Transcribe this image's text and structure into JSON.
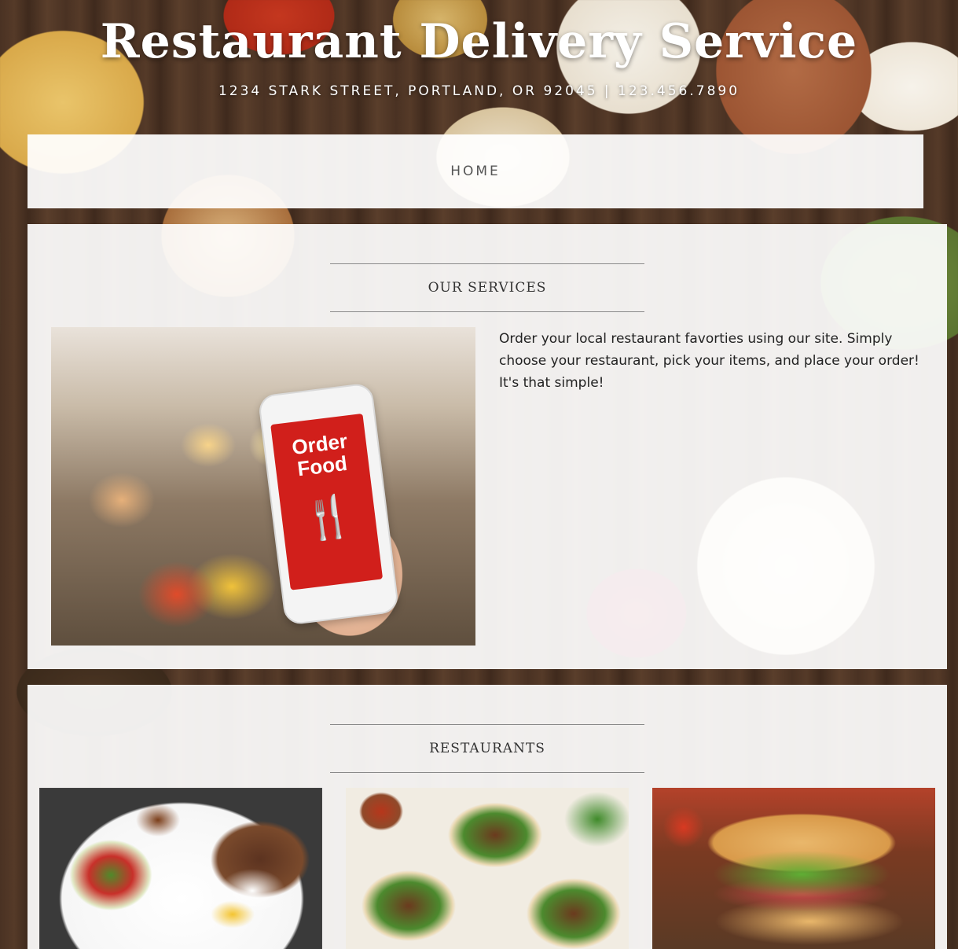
{
  "header": {
    "title": "Restaurant Delivery Service",
    "subtitle": "1234 STARK STREET, PORTLAND, OR 92045 | 123.456.7890"
  },
  "nav": {
    "items": [
      {
        "label": "HOME"
      }
    ]
  },
  "services": {
    "heading": "OUR SERVICES",
    "image": {
      "phone_text": "Order Food"
    },
    "description": "Order your local restaurant favorties using our site. Simply choose your restaurant, pick your items, and place your order! It's that simple!"
  },
  "restaurants": {
    "heading": "RESTAURANTS"
  }
}
